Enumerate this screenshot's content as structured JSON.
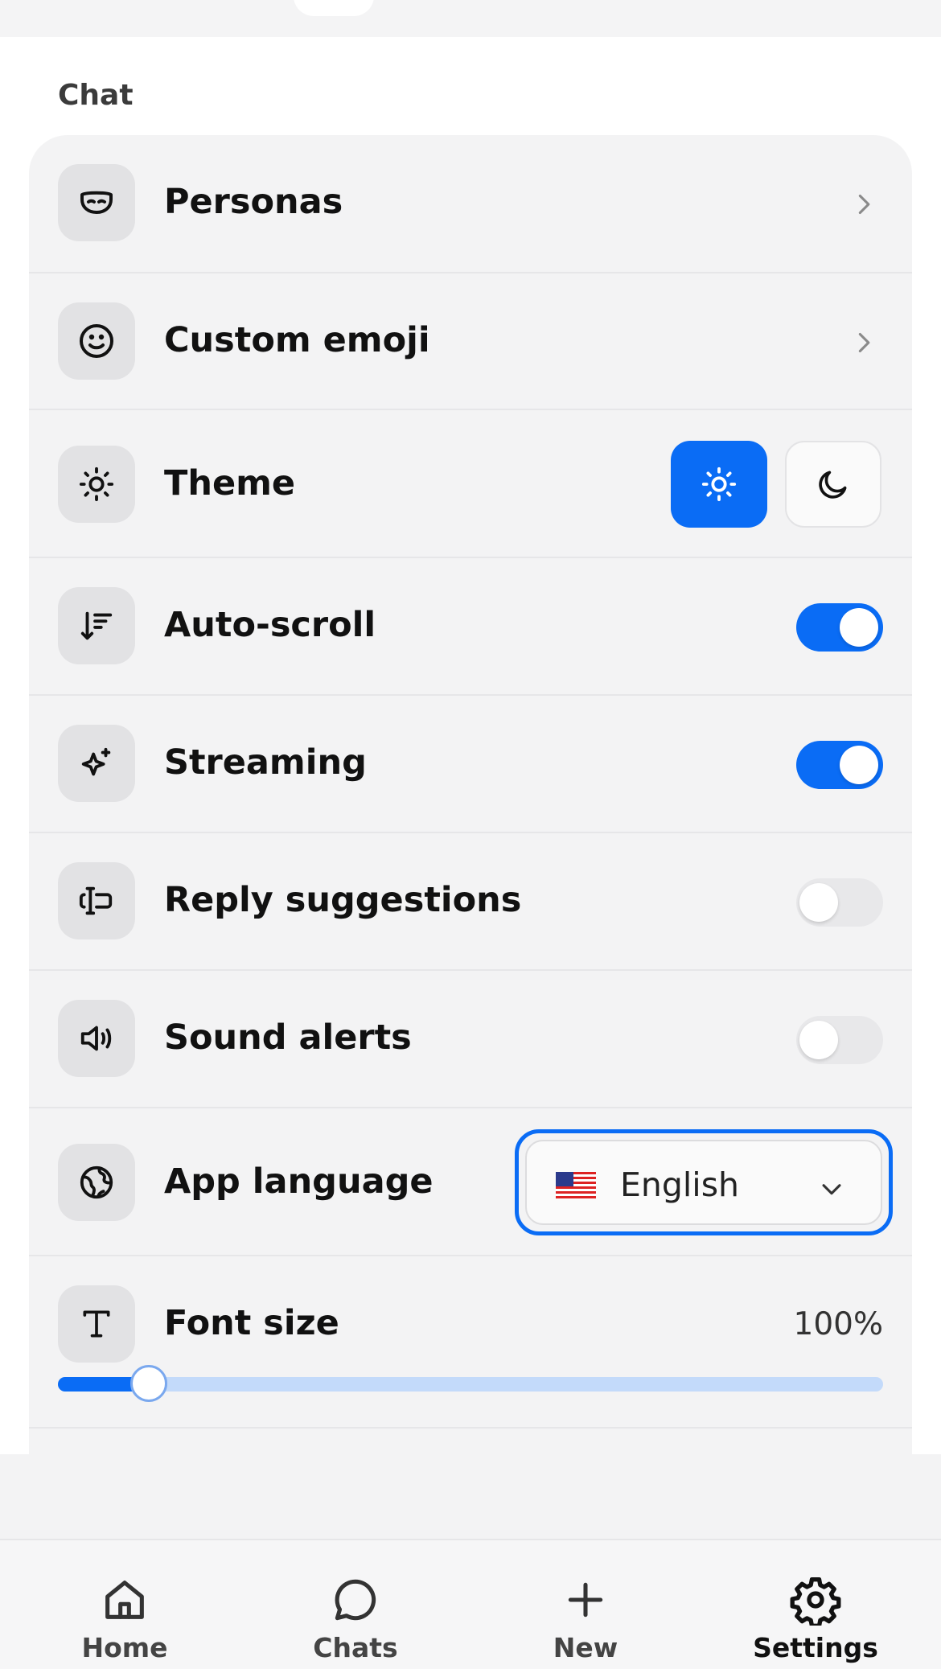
{
  "section": {
    "title": "Chat"
  },
  "rows": {
    "personas": {
      "label": "Personas",
      "icon": "mask-icon"
    },
    "custom_emoji": {
      "label": "Custom emoji",
      "icon": "smiley-icon"
    },
    "theme": {
      "label": "Theme",
      "icon": "sun-icon",
      "selected": "light"
    },
    "auto_scroll": {
      "label": "Auto-scroll",
      "icon": "sort-down-icon",
      "enabled": true
    },
    "streaming": {
      "label": "Streaming",
      "icon": "sparkle-icon",
      "enabled": true
    },
    "reply_suggestions": {
      "label": "Reply suggestions",
      "icon": "text-cursor-icon",
      "enabled": false
    },
    "sound_alerts": {
      "label": "Sound alerts",
      "icon": "speaker-icon",
      "enabled": false
    },
    "app_language": {
      "label": "App language",
      "icon": "globe-icon",
      "value": "English",
      "flag": "us-flag-icon"
    },
    "font_size": {
      "label": "Font size",
      "icon": "type-icon",
      "value": "100%",
      "slider_fraction": 0.11
    }
  },
  "nav": {
    "home": "Home",
    "chats": "Chats",
    "new": "New",
    "settings": "Settings",
    "active": "settings"
  },
  "colors": {
    "accent": "#0a6cf5",
    "card_bg": "#f3f3f4",
    "icon_bg": "#e2e2e4"
  }
}
